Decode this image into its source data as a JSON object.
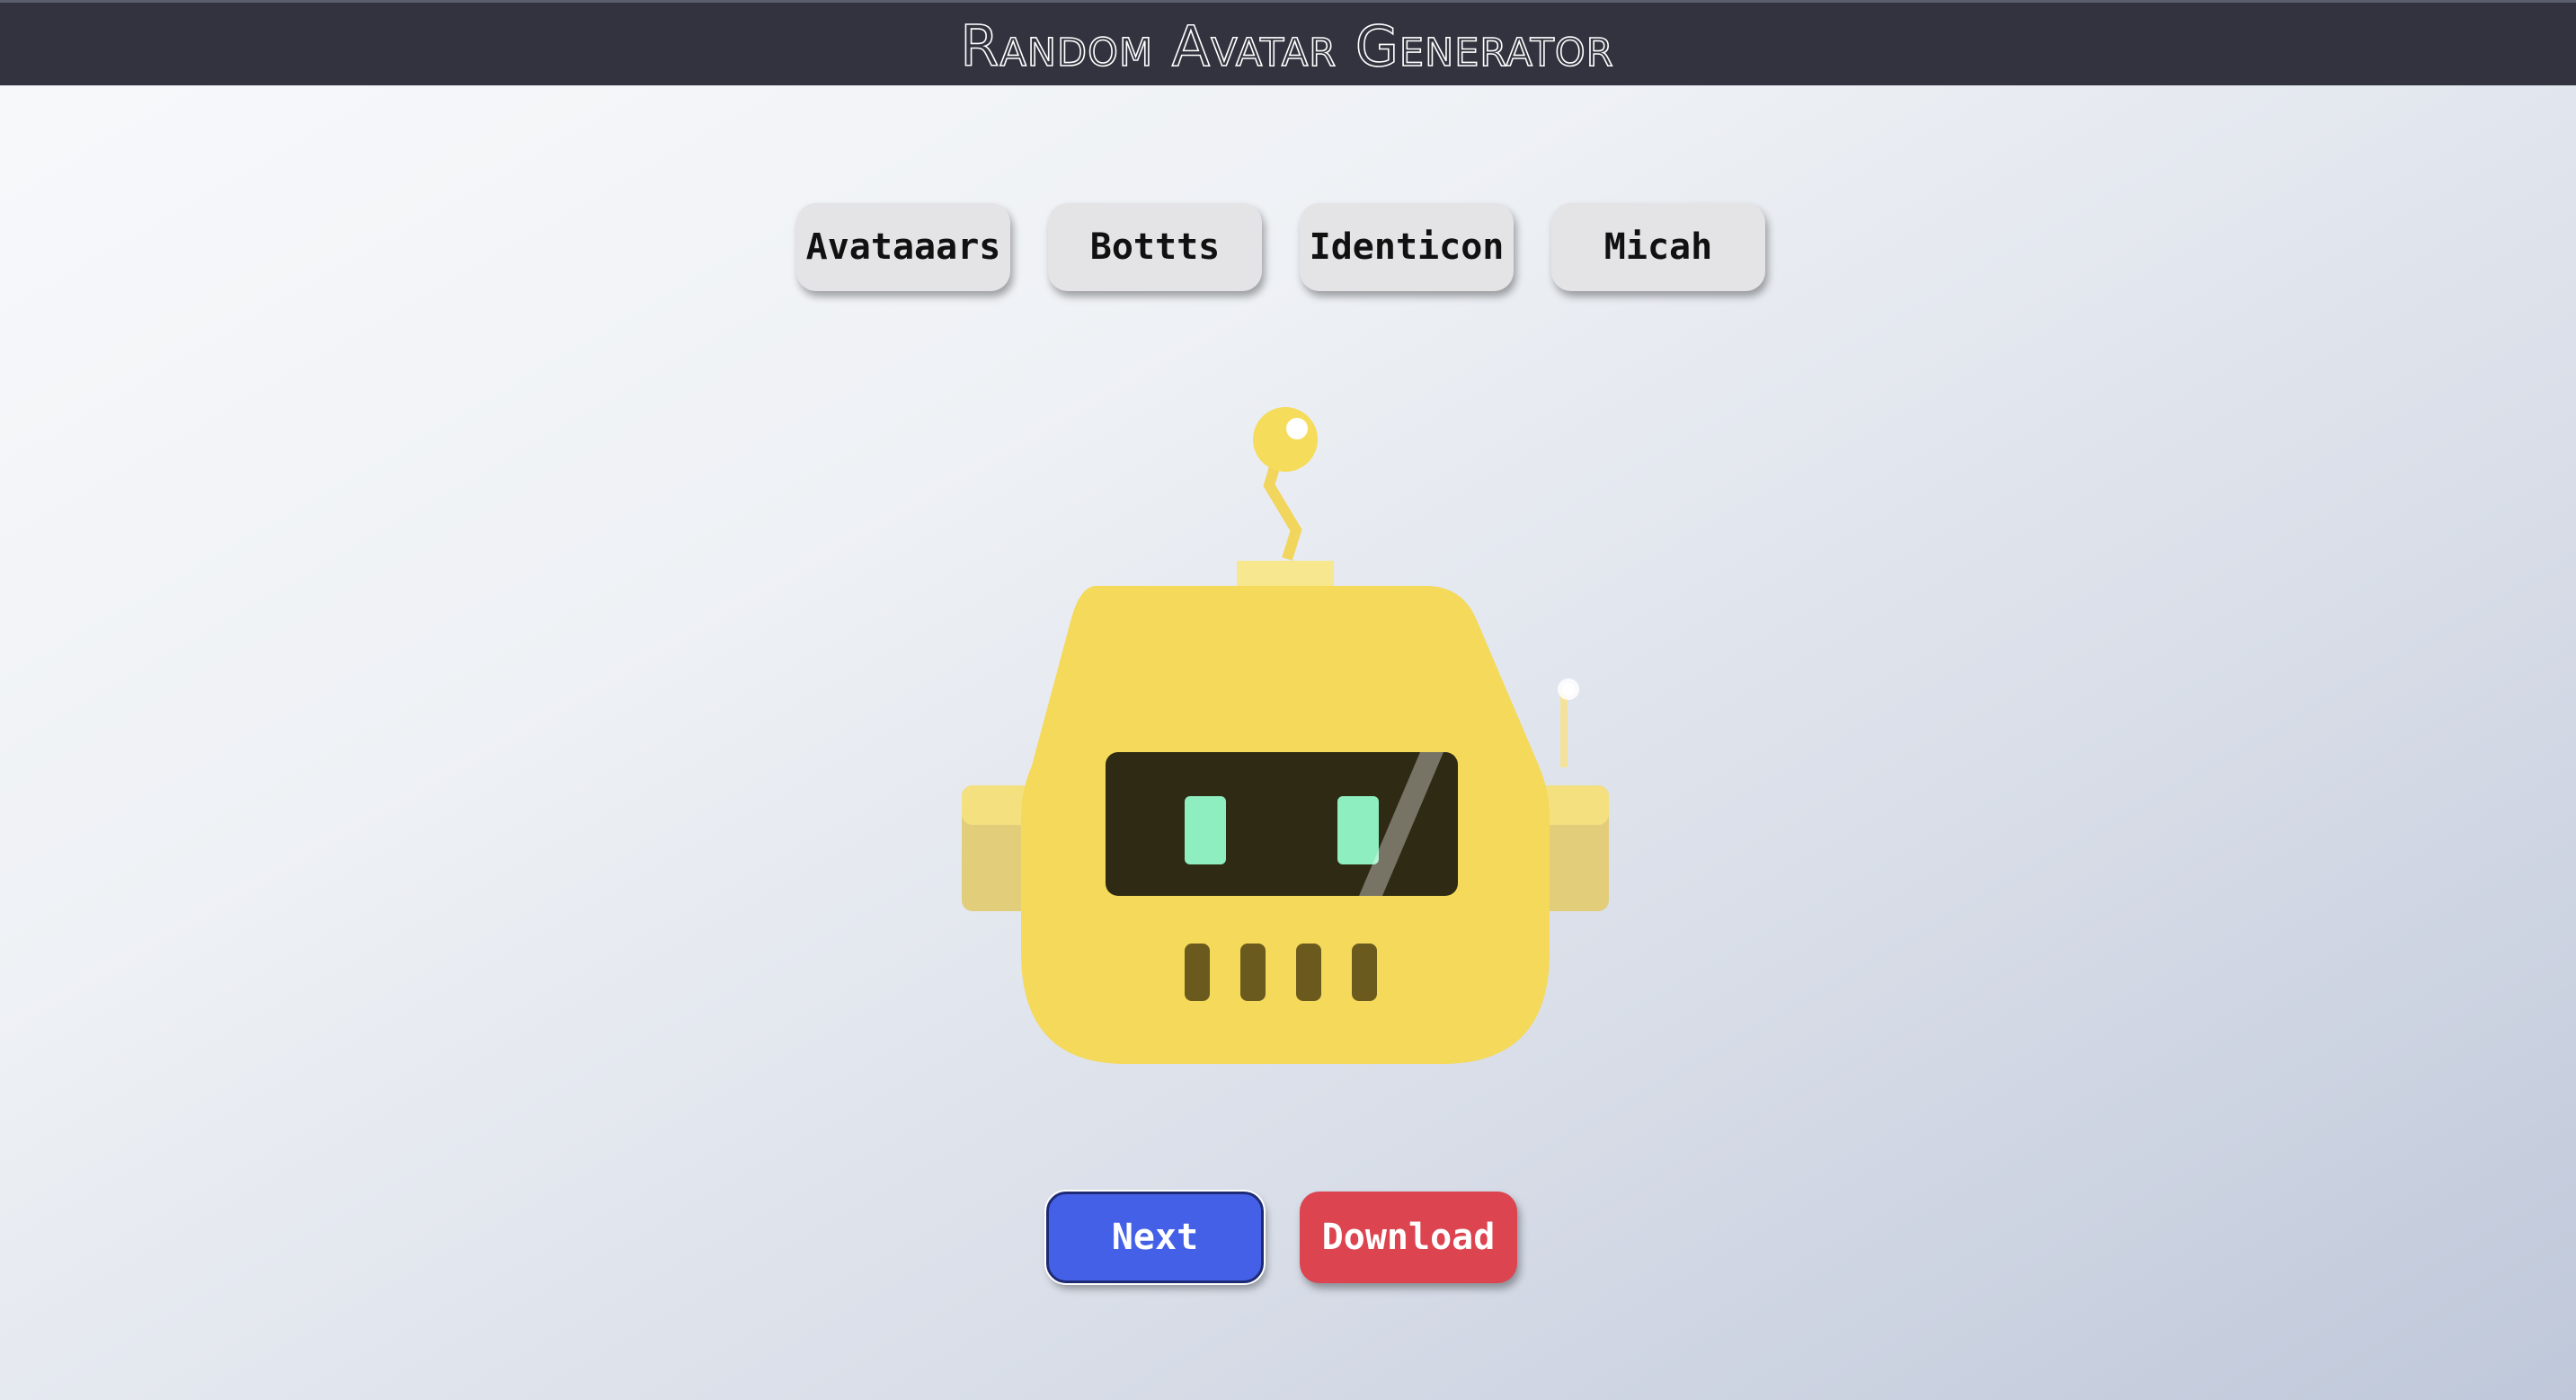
{
  "header": {
    "title": "Random Avatar Generator"
  },
  "styles": [
    {
      "label": "Avataaars"
    },
    {
      "label": "Bottts"
    },
    {
      "label": "Identicon"
    },
    {
      "label": "Micah"
    }
  ],
  "actions": {
    "next_label": "Next",
    "download_label": "Download"
  },
  "colors": {
    "header_bg": "#32333f",
    "robot_face": "#f5d95a",
    "robot_ears": "#e2cd7a",
    "robot_visor": "#2e2a14",
    "robot_eyes": "#8eeebf",
    "next_button": "#4460e6",
    "download_button": "#dc4450"
  }
}
